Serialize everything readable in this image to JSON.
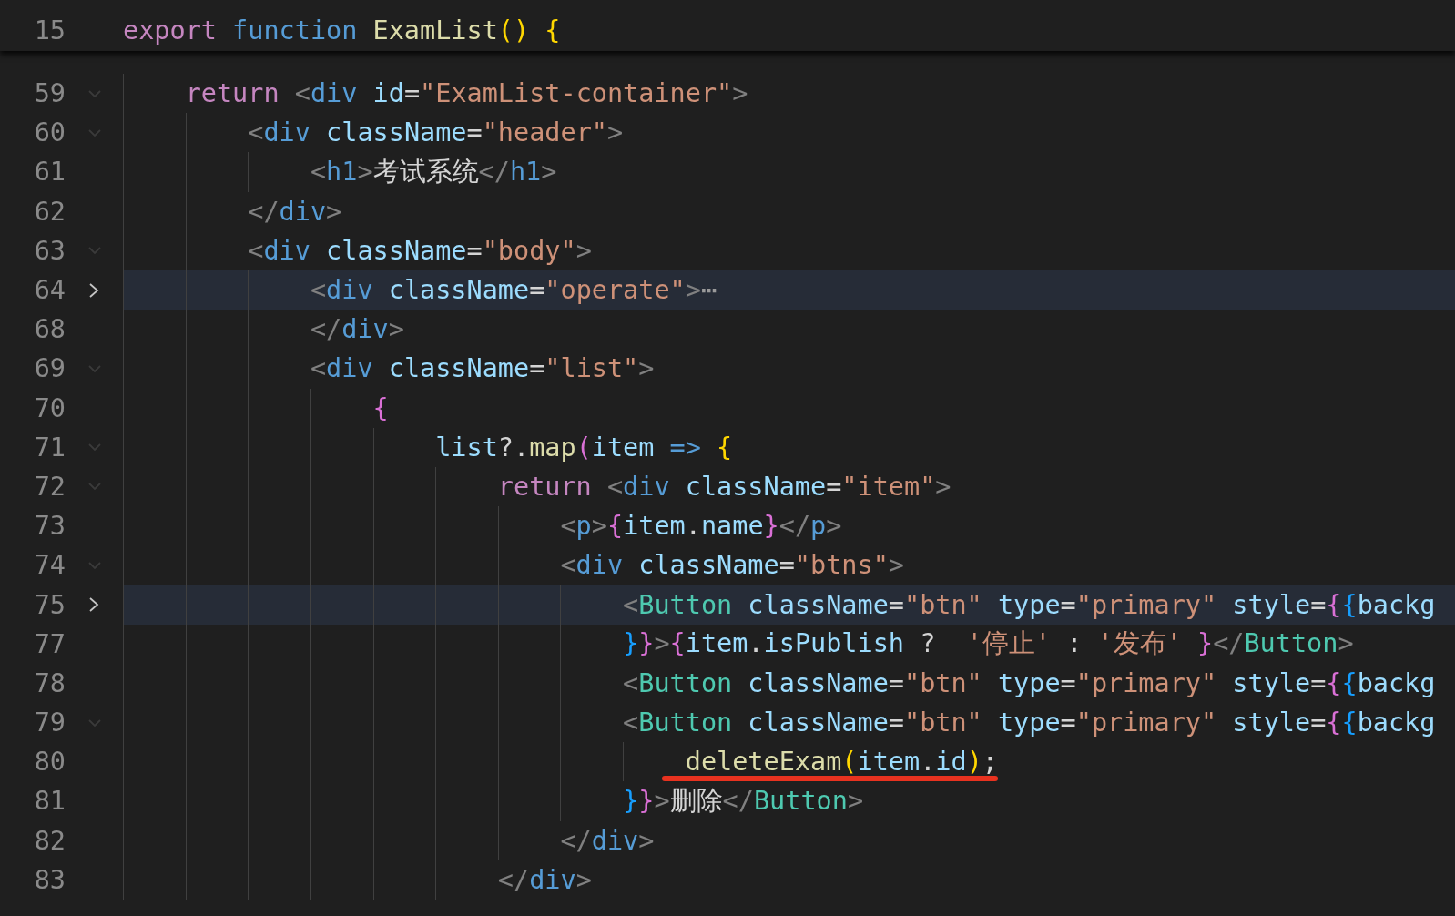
{
  "sticky_line": {
    "number": "15",
    "tokens": [
      {
        "kind": "keyword",
        "text": "export "
      },
      {
        "kind": "storage",
        "text": "function "
      },
      {
        "kind": "function",
        "text": "ExamList"
      },
      {
        "kind": "bracket1",
        "text": "() {"
      }
    ]
  },
  "lines": [
    {
      "number": "59",
      "collapsed": false,
      "tokens": [
        {
          "kind": "keyword",
          "text": "return "
        },
        {
          "kind": "punct",
          "text": "<"
        },
        {
          "kind": "tag",
          "text": "div"
        },
        {
          "kind": "attr",
          "text": " id"
        },
        {
          "kind": "text",
          "text": "="
        },
        {
          "kind": "string",
          "text": "\"ExamList-container\""
        },
        {
          "kind": "punct",
          "text": ">"
        }
      ],
      "children": [
        {
          "number": "60",
          "collapsed": false,
          "tokens": [
            {
              "kind": "punct",
              "text": "<"
            },
            {
              "kind": "tag",
              "text": "div"
            },
            {
              "kind": "attr",
              "text": " className"
            },
            {
              "kind": "text",
              "text": "="
            },
            {
              "kind": "string",
              "text": "\"header\""
            },
            {
              "kind": "punct",
              "text": ">"
            }
          ],
          "children": [
            {
              "number": "61",
              "tokens": [
                {
                  "kind": "punct",
                  "text": "<"
                },
                {
                  "kind": "tag",
                  "text": "h1"
                },
                {
                  "kind": "punct",
                  "text": ">"
                },
                {
                  "kind": "text",
                  "text": "考试系统"
                },
                {
                  "kind": "punct",
                  "text": "</"
                },
                {
                  "kind": "tag",
                  "text": "h1"
                },
                {
                  "kind": "punct",
                  "text": ">"
                }
              ]
            }
          ]
        },
        {
          "number": "62",
          "tokens": [
            {
              "kind": "punct",
              "text": "</"
            },
            {
              "kind": "tag",
              "text": "div"
            },
            {
              "kind": "punct",
              "text": ">"
            }
          ]
        },
        {
          "number": "63",
          "collapsed": false,
          "tokens": [
            {
              "kind": "punct",
              "text": "<"
            },
            {
              "kind": "tag",
              "text": "div"
            },
            {
              "kind": "attr",
              "text": " className"
            },
            {
              "kind": "text",
              "text": "="
            },
            {
              "kind": "string",
              "text": "\"body\""
            },
            {
              "kind": "punct",
              "text": ">"
            }
          ],
          "children": [
            {
              "number": "64",
              "collapsed": true,
              "tokens": [
                {
                  "kind": "punct",
                  "text": "<"
                },
                {
                  "kind": "tag",
                  "text": "div"
                },
                {
                  "kind": "attr",
                  "text": " className"
                },
                {
                  "kind": "text",
                  "text": "="
                },
                {
                  "kind": "string",
                  "text": "\"operate\""
                },
                {
                  "kind": "punct",
                  "text": ">"
                },
                {
                  "kind": "ellipsis",
                  "text": "⋯"
                }
              ]
            },
            {
              "number": "68",
              "tokens": [
                {
                  "kind": "punct",
                  "text": "</"
                },
                {
                  "kind": "tag",
                  "text": "div"
                },
                {
                  "kind": "punct",
                  "text": ">"
                }
              ]
            },
            {
              "number": "69",
              "collapsed": false,
              "tokens": [
                {
                  "kind": "punct",
                  "text": "<"
                },
                {
                  "kind": "tag",
                  "text": "div"
                },
                {
                  "kind": "attr",
                  "text": " className"
                },
                {
                  "kind": "text",
                  "text": "="
                },
                {
                  "kind": "string",
                  "text": "\"list\""
                },
                {
                  "kind": "punct",
                  "text": ">"
                }
              ],
              "children": [
                {
                  "number": "70",
                  "tokens": [
                    {
                      "kind": "bracket2",
                      "text": "{"
                    }
                  ],
                  "children": [
                    {
                      "number": "71",
                      "collapsed": false,
                      "tokens": [
                        {
                          "kind": "var",
                          "text": "list"
                        },
                        {
                          "kind": "text",
                          "text": "?."
                        },
                        {
                          "kind": "function",
                          "text": "map"
                        },
                        {
                          "kind": "bracket2",
                          "text": "("
                        },
                        {
                          "kind": "var",
                          "text": "item"
                        },
                        {
                          "kind": "storage",
                          "text": " => "
                        },
                        {
                          "kind": "bracket1",
                          "text": "{"
                        }
                      ],
                      "children": [
                        {
                          "number": "72",
                          "collapsed": false,
                          "tokens": [
                            {
                              "kind": "keyword",
                              "text": "return "
                            },
                            {
                              "kind": "punct",
                              "text": "<"
                            },
                            {
                              "kind": "tag",
                              "text": "div"
                            },
                            {
                              "kind": "attr",
                              "text": " className"
                            },
                            {
                              "kind": "text",
                              "text": "="
                            },
                            {
                              "kind": "string",
                              "text": "\"item\""
                            },
                            {
                              "kind": "punct",
                              "text": ">"
                            }
                          ],
                          "children": [
                            {
                              "number": "73",
                              "tokens": [
                                {
                                  "kind": "punct",
                                  "text": "<"
                                },
                                {
                                  "kind": "tag",
                                  "text": "p"
                                },
                                {
                                  "kind": "punct",
                                  "text": ">"
                                },
                                {
                                  "kind": "bracket2",
                                  "text": "{"
                                },
                                {
                                  "kind": "var",
                                  "text": "item"
                                },
                                {
                                  "kind": "text",
                                  "text": "."
                                },
                                {
                                  "kind": "var",
                                  "text": "name"
                                },
                                {
                                  "kind": "bracket2",
                                  "text": "}"
                                },
                                {
                                  "kind": "punct",
                                  "text": "</"
                                },
                                {
                                  "kind": "tag",
                                  "text": "p"
                                },
                                {
                                  "kind": "punct",
                                  "text": ">"
                                }
                              ]
                            },
                            {
                              "number": "74",
                              "collapsed": false,
                              "tokens": [
                                {
                                  "kind": "punct",
                                  "text": "<"
                                },
                                {
                                  "kind": "tag",
                                  "text": "div"
                                },
                                {
                                  "kind": "attr",
                                  "text": " className"
                                },
                                {
                                  "kind": "text",
                                  "text": "="
                                },
                                {
                                  "kind": "string",
                                  "text": "\"btns\""
                                },
                                {
                                  "kind": "punct",
                                  "text": ">"
                                }
                              ],
                              "children": [
                                {
                                  "number": "75",
                                  "collapsed": true,
                                  "tokens": [
                                    {
                                      "kind": "punct",
                                      "text": "<"
                                    },
                                    {
                                      "kind": "component",
                                      "text": "Button"
                                    },
                                    {
                                      "kind": "attr",
                                      "text": " className"
                                    },
                                    {
                                      "kind": "text",
                                      "text": "="
                                    },
                                    {
                                      "kind": "string",
                                      "text": "\"btn\""
                                    },
                                    {
                                      "kind": "attr",
                                      "text": " type"
                                    },
                                    {
                                      "kind": "text",
                                      "text": "="
                                    },
                                    {
                                      "kind": "string",
                                      "text": "\"primary\""
                                    },
                                    {
                                      "kind": "attr",
                                      "text": " style"
                                    },
                                    {
                                      "kind": "text",
                                      "text": "="
                                    },
                                    {
                                      "kind": "bracket2",
                                      "text": "{"
                                    },
                                    {
                                      "kind": "bracket3",
                                      "text": "{"
                                    },
                                    {
                                      "kind": "var",
                                      "text": "backg"
                                    }
                                  ]
                                },
                                {
                                  "number": "77",
                                  "tokens": [
                                    {
                                      "kind": "bracket3",
                                      "text": "}"
                                    },
                                    {
                                      "kind": "bracket2",
                                      "text": "}"
                                    },
                                    {
                                      "kind": "punct",
                                      "text": ">"
                                    },
                                    {
                                      "kind": "bracket2",
                                      "text": "{"
                                    },
                                    {
                                      "kind": "var",
                                      "text": "item"
                                    },
                                    {
                                      "kind": "text",
                                      "text": "."
                                    },
                                    {
                                      "kind": "var",
                                      "text": "isPublish"
                                    },
                                    {
                                      "kind": "text",
                                      "text": " ?  "
                                    },
                                    {
                                      "kind": "string",
                                      "text": "'停止'"
                                    },
                                    {
                                      "kind": "text",
                                      "text": " : "
                                    },
                                    {
                                      "kind": "string",
                                      "text": "'发布'"
                                    },
                                    {
                                      "kind": "bracket2",
                                      "text": " }"
                                    },
                                    {
                                      "kind": "punct",
                                      "text": "</"
                                    },
                                    {
                                      "kind": "component",
                                      "text": "Button"
                                    },
                                    {
                                      "kind": "punct",
                                      "text": ">"
                                    }
                                  ]
                                },
                                {
                                  "number": "78",
                                  "tokens": [
                                    {
                                      "kind": "punct",
                                      "text": "<"
                                    },
                                    {
                                      "kind": "component",
                                      "text": "Button"
                                    },
                                    {
                                      "kind": "attr",
                                      "text": " className"
                                    },
                                    {
                                      "kind": "text",
                                      "text": "="
                                    },
                                    {
                                      "kind": "string",
                                      "text": "\"btn\""
                                    },
                                    {
                                      "kind": "attr",
                                      "text": " type"
                                    },
                                    {
                                      "kind": "text",
                                      "text": "="
                                    },
                                    {
                                      "kind": "string",
                                      "text": "\"primary\""
                                    },
                                    {
                                      "kind": "attr",
                                      "text": " style"
                                    },
                                    {
                                      "kind": "text",
                                      "text": "="
                                    },
                                    {
                                      "kind": "bracket2",
                                      "text": "{"
                                    },
                                    {
                                      "kind": "bracket3",
                                      "text": "{"
                                    },
                                    {
                                      "kind": "var",
                                      "text": "backg"
                                    }
                                  ]
                                },
                                {
                                  "number": "79",
                                  "collapsed": false,
                                  "tokens": [
                                    {
                                      "kind": "punct",
                                      "text": "<"
                                    },
                                    {
                                      "kind": "component",
                                      "text": "Button"
                                    },
                                    {
                                      "kind": "attr",
                                      "text": " className"
                                    },
                                    {
                                      "kind": "text",
                                      "text": "="
                                    },
                                    {
                                      "kind": "string",
                                      "text": "\"btn\""
                                    },
                                    {
                                      "kind": "attr",
                                      "text": " type"
                                    },
                                    {
                                      "kind": "text",
                                      "text": "="
                                    },
                                    {
                                      "kind": "string",
                                      "text": "\"primary\""
                                    },
                                    {
                                      "kind": "attr",
                                      "text": " style"
                                    },
                                    {
                                      "kind": "text",
                                      "text": "="
                                    },
                                    {
                                      "kind": "bracket2",
                                      "text": "{"
                                    },
                                    {
                                      "kind": "bracket3",
                                      "text": "{"
                                    },
                                    {
                                      "kind": "var",
                                      "text": "backg"
                                    }
                                  ],
                                  "children": [
                                    {
                                      "number": "80",
                                      "underlined": true,
                                      "tokens": [
                                        {
                                          "kind": "function",
                                          "text": "deleteExam"
                                        },
                                        {
                                          "kind": "bracket1",
                                          "text": "("
                                        },
                                        {
                                          "kind": "var",
                                          "text": "item"
                                        },
                                        {
                                          "kind": "text",
                                          "text": "."
                                        },
                                        {
                                          "kind": "var",
                                          "text": "id"
                                        },
                                        {
                                          "kind": "bracket1",
                                          "text": ")"
                                        },
                                        {
                                          "kind": "text",
                                          "text": ";"
                                        }
                                      ]
                                    }
                                  ]
                                },
                                {
                                  "number": "81",
                                  "tokens": [
                                    {
                                      "kind": "bracket3",
                                      "text": "}"
                                    },
                                    {
                                      "kind": "bracket2",
                                      "text": "}"
                                    },
                                    {
                                      "kind": "punct",
                                      "text": ">"
                                    },
                                    {
                                      "kind": "text",
                                      "text": "删除"
                                    },
                                    {
                                      "kind": "punct",
                                      "text": "</"
                                    },
                                    {
                                      "kind": "component",
                                      "text": "Button"
                                    },
                                    {
                                      "kind": "punct",
                                      "text": ">"
                                    }
                                  ]
                                }
                              ]
                            },
                            {
                              "number": "82",
                              "tokens": [
                                {
                                  "kind": "punct",
                                  "text": "</"
                                },
                                {
                                  "kind": "tag",
                                  "text": "div"
                                },
                                {
                                  "kind": "punct",
                                  "text": ">"
                                }
                              ]
                            }
                          ]
                        },
                        {
                          "number": "83",
                          "tokens": [
                            {
                              "kind": "punct",
                              "text": "</"
                            },
                            {
                              "kind": "tag",
                              "text": "div"
                            },
                            {
                              "kind": "punct",
                              "text": ">"
                            }
                          ]
                        }
                      ]
                    }
                  ]
                }
              ]
            }
          ]
        }
      ]
    }
  ]
}
